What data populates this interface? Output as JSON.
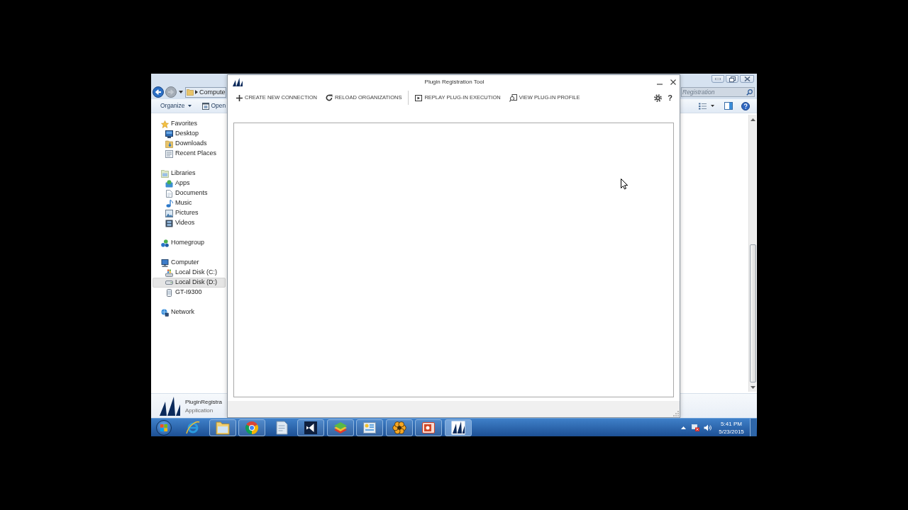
{
  "explorer": {
    "back": {
      "disabled": false
    },
    "forward": {
      "disabled": true
    },
    "address": {
      "path": "Compute"
    },
    "search": {
      "placeholder": "Registration"
    },
    "toolbar": [
      {
        "label": "Organize",
        "kind": "menu"
      },
      {
        "label": "Open",
        "kind": "command"
      }
    ],
    "navigation": [
      {
        "label": "Favorites",
        "selected": false,
        "children": [
          {
            "label": "Desktop",
            "selected": false
          },
          {
            "label": "Downloads",
            "selected": false
          },
          {
            "label": "Recent Places",
            "selected": false
          }
        ]
      },
      {
        "label": "Libraries",
        "selected": false,
        "children": [
          {
            "label": "Apps",
            "selected": false
          },
          {
            "label": "Documents",
            "selected": false
          },
          {
            "label": "Music",
            "selected": false
          },
          {
            "label": "Pictures",
            "selected": false
          },
          {
            "label": "Videos",
            "selected": false
          }
        ]
      },
      {
        "label": "Homegroup",
        "selected": false
      },
      {
        "label": "Computer",
        "selected": false,
        "children": [
          {
            "label": "Local Disk (C:)",
            "selected": false
          },
          {
            "label": "Local Disk (D:)",
            "selected": true
          },
          {
            "label": "GT-I9300",
            "selected": false
          }
        ]
      },
      {
        "label": "Network",
        "selected": false
      }
    ],
    "details": {
      "name": "PluginRegistra",
      "type": "Application"
    }
  },
  "plugin_tool": {
    "title": "Plugin Registration Tool",
    "toolbar_groups": [
      [
        {
          "label": "CREATE NEW CONNECTION"
        },
        {
          "label": "RELOAD ORGANIZATIONS"
        }
      ],
      [
        {
          "label": "REPLAY PLUG-IN EXECUTION"
        },
        {
          "label": "VIEW PLUG-IN PROFILE"
        }
      ]
    ],
    "help_button": "?"
  },
  "taskbar": {
    "apps": [
      {
        "running": false,
        "active": false
      },
      {
        "running": true,
        "active": false
      },
      {
        "running": true,
        "active": false
      },
      {
        "running": false,
        "active": false
      },
      {
        "running": true,
        "active": false
      },
      {
        "running": true,
        "active": false
      },
      {
        "running": true,
        "active": false
      },
      {
        "running": true,
        "active": false
      },
      {
        "running": true,
        "active": false
      },
      {
        "running": true,
        "active": true
      }
    ],
    "clock": {
      "time": "5:41 PM",
      "date": "5/23/2015"
    }
  }
}
